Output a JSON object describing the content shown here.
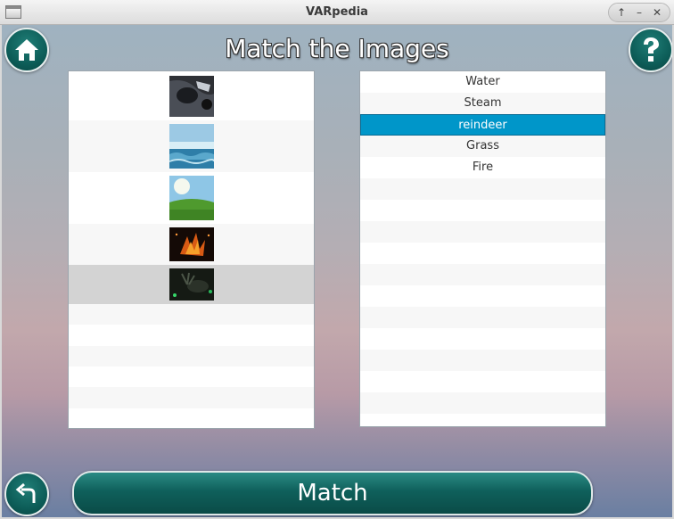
{
  "window": {
    "title": "VARpedia"
  },
  "header": {
    "title": "Match the Images"
  },
  "image_list": {
    "items": [
      {
        "name": "img-car-closeup",
        "selected": false
      },
      {
        "name": "img-water-waves",
        "selected": false
      },
      {
        "name": "img-grass-field",
        "selected": false
      },
      {
        "name": "img-fire-sparks",
        "selected": false
      },
      {
        "name": "img-dark-reindeer",
        "selected": true
      }
    ]
  },
  "word_list": {
    "items": [
      {
        "label": "Water",
        "selected": false
      },
      {
        "label": "Steam",
        "selected": false
      },
      {
        "label": "reindeer",
        "selected": true
      },
      {
        "label": "Grass",
        "selected": false
      },
      {
        "label": "Fire",
        "selected": false
      }
    ]
  },
  "buttons": {
    "match_label": "Match"
  },
  "colors": {
    "accent": "#0096c9",
    "button_teal": "#0f605b"
  }
}
